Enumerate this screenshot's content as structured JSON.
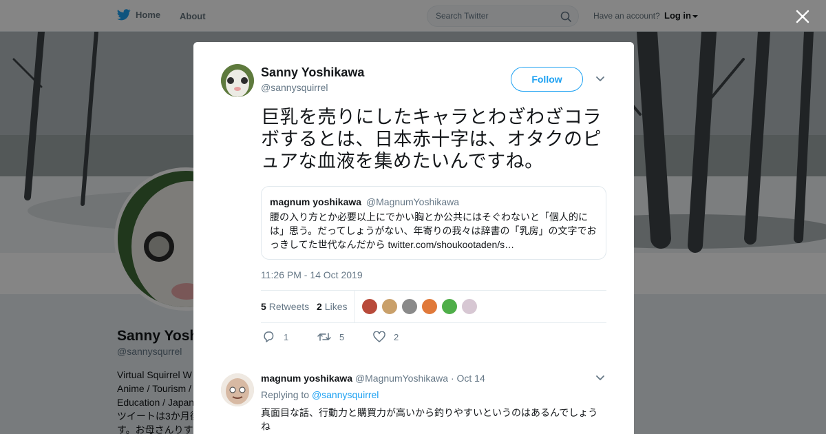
{
  "nav": {
    "home_label": "Home",
    "about_label": "About",
    "search_placeholder": "Search Twitter",
    "account_prompt": "Have an account?",
    "login_label": "Log in"
  },
  "profile": {
    "name": "Sanny Yoshikawa",
    "handle": "@sannysqurrel",
    "bio_lines": [
      "Virtual Squirrel W",
      "Anime / Tourism /",
      "Education / Japan",
      "ツイートは3か月後",
      "す。お母さんりす"
    ]
  },
  "tweet": {
    "author_name": "Sanny Yoshikawa",
    "author_handle": "@sannysquirrel",
    "follow_label": "Follow",
    "text": "巨乳を売りにしたキャラとわざわざコラボするとは、日本赤十字は、オタクのピュアな血液を集めたいんですね。",
    "quote": {
      "name": "magnum yoshikawa",
      "handle": "@MagnumYoshikawa",
      "text": "腰の入り方とか必要以上にでかい胸とか公共にはそぐわないと「個人的には」思う。だってしょうがない、年寄りの我々は辞書の「乳房」の文字でおっきしてた世代なんだから twitter.com/shoukootaden/s…"
    },
    "timestamp": "11:26 PM - 14 Oct 2019",
    "retweets_count": "5",
    "retweets_label": "Retweets",
    "likes_count": "2",
    "likes_label": "Likes",
    "actions": {
      "reply_count": "1",
      "retweet_count": "5",
      "like_count": "2"
    }
  },
  "reply": {
    "name": "magnum yoshikawa",
    "handle": "@MagnumYoshikawa",
    "date": "· Oct 14",
    "replying_prefix": "Replying to",
    "replying_to": "@sannysquirrel",
    "text": "真面目な話、行動力と購買力が高いから釣りやすいというのはあるんでしょうね"
  },
  "colors": {
    "accent": "#1da1f2",
    "text": "#14171a",
    "muted": "#657786"
  }
}
